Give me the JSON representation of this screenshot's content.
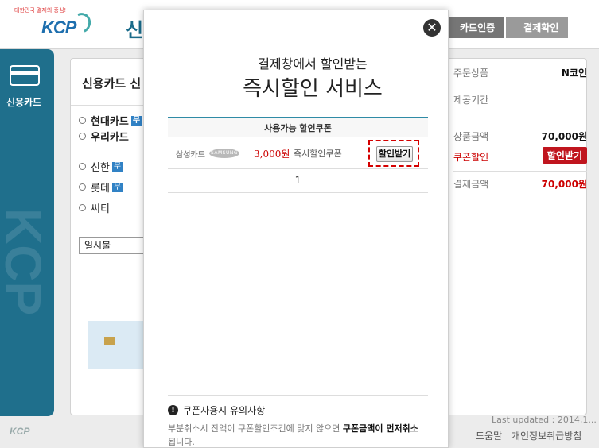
{
  "header": {
    "logo_tagline": "대한민국 결제의 중심!",
    "logo_text": "KCP",
    "title_partial": "신",
    "steps": [
      "카드인증",
      "결제확인"
    ]
  },
  "sidebar": {
    "item_label": "신용카드",
    "watermark": "KCP"
  },
  "main": {
    "title": "신용카드 신",
    "cards_a": [
      "현대카드",
      "우리카드"
    ],
    "cards_b": [
      "신한",
      "롯데",
      "씨티"
    ],
    "free_badge": "무",
    "installment": "일시불"
  },
  "summary": {
    "product_label": "주문상품",
    "product_value": "N코인",
    "period_label": "제공기간",
    "price_label": "상품금액",
    "price_value": "70,000원",
    "coupon_label": "쿠폰할인",
    "coupon_button": "할인받기",
    "total_label": "결제금액",
    "total_value": "70,000원"
  },
  "footer": {
    "updated": "Last updated : 2014,1...",
    "links": [
      "도움말",
      "개인정보취급방침"
    ],
    "logo": "KCP"
  },
  "modal": {
    "close_symbol": "✕",
    "subtitle": "결제창에서 할인받는",
    "title": "즉시할인 서비스",
    "table_header": "사용가능 할인쿠폰",
    "coupon": {
      "card_name": "삼성카드",
      "card_logo": "SAMSUNG",
      "amount": "3,000원",
      "type": "즉시할인쿠폰",
      "apply_button": "할인받기"
    },
    "page": "1",
    "notice_title": "쿠폰사용시 유의사항",
    "notice_text_1": "부분취소시 잔액이 쿠폰할인조건에 맞지 않으면 ",
    "notice_text_bold": "쿠폰금액이 먼저취소",
    "notice_text_2": " 됩니다."
  },
  "colors": {
    "accent": "#1f6f8c",
    "danger": "#c00000",
    "highlight": "#d40000"
  }
}
